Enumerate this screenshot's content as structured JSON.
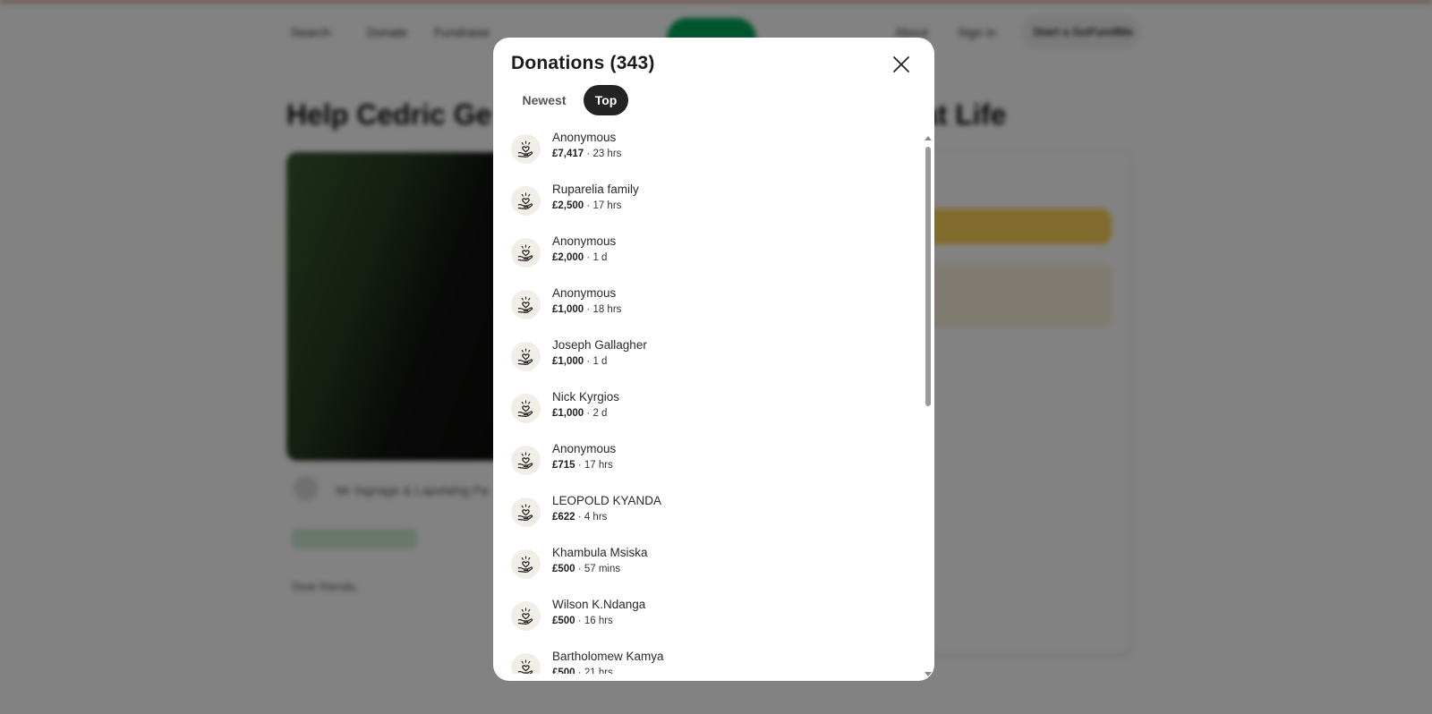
{
  "background": {
    "nav": {
      "search": "Search",
      "donate": "Donate",
      "fundraise": "Fundraise",
      "about": "About",
      "sign_in": "Sign in",
      "start_cta": "Start a GoFundMe"
    },
    "title_left": "Help Cedric Ge",
    "title_right": "at Life",
    "organizer": "Mr Signage & Lapolahig Pa",
    "greeting": "Dear friends,"
  },
  "modal": {
    "title": "Donations (343)",
    "tabs": [
      {
        "label": "Newest",
        "selected": false
      },
      {
        "label": "Top",
        "selected": true
      }
    ],
    "donations": [
      {
        "name": "Anonymous",
        "amount": "£7,417",
        "time": "23 hrs"
      },
      {
        "name": "Ruparelia family",
        "amount": "£2,500",
        "time": "17 hrs"
      },
      {
        "name": "Anonymous",
        "amount": "£2,000",
        "time": "1 d"
      },
      {
        "name": "Anonymous",
        "amount": "£1,000",
        "time": "18 hrs"
      },
      {
        "name": "Joseph Gallagher",
        "amount": "£1,000",
        "time": "1 d"
      },
      {
        "name": "Nick Kyrgios",
        "amount": "£1,000",
        "time": "2 d"
      },
      {
        "name": "Anonymous",
        "amount": "£715",
        "time": "17 hrs"
      },
      {
        "name": "LEOPOLD KYANDA",
        "amount": "£622",
        "time": "4 hrs"
      },
      {
        "name": "Khambula Msiska",
        "amount": "£500",
        "time": "57 mins"
      },
      {
        "name": "Wilson K.Ndanga",
        "amount": "£500",
        "time": "16 hrs"
      },
      {
        "name": "Bartholomew Kamya",
        "amount": "£500",
        "time": "21 hrs"
      }
    ],
    "separator": "·",
    "donor_icon": "heart-hand-icon",
    "close_icon": "close-icon"
  },
  "colors": {
    "overlay": "rgba(0,0,0,0.49)",
    "selected_tab": "#232323",
    "donor_icon_bg": "#f1eee8"
  }
}
